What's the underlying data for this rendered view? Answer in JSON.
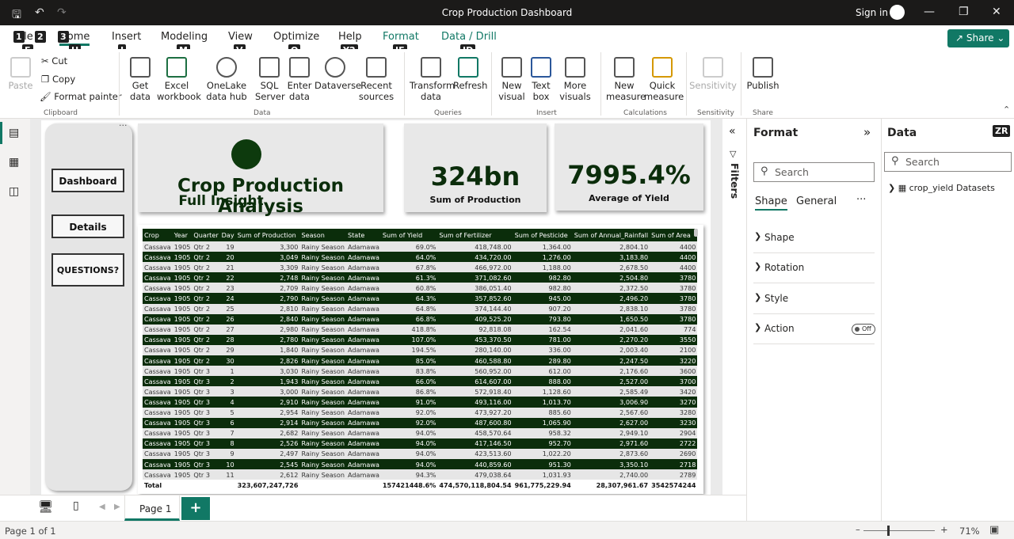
{
  "window": {
    "title": "Crop Production Dashboard",
    "sign_in": "Sign in"
  },
  "tabs": [
    "File",
    "Home",
    "Insert",
    "Modeling",
    "View",
    "Optimize",
    "Help",
    "Format",
    "Data / Drill"
  ],
  "keytips": {
    "file": "1",
    "tb2": "2",
    "tb3": "3",
    "home": "H",
    "insert": "I",
    "modeling": "M",
    "view": "V",
    "optimize": "O",
    "help": "Y2",
    "format": "JF",
    "drill": "JD",
    "paste": "F",
    "share": "S",
    "data": "ZR"
  },
  "share": "Share",
  "clipboard": {
    "paste": "Paste",
    "cut": "Cut",
    "copy": "Copy",
    "format_painter": "Format painter",
    "group": "Clipboard"
  },
  "data_group": {
    "get_data": "Get data",
    "excel": "Excel workbook",
    "onelake": "OneLake data hub",
    "sql": "SQL Server",
    "enter": "Enter data",
    "dataverse": "Dataverse",
    "recent": "Recent sources",
    "group": "Data"
  },
  "queries": {
    "transform": "Transform data",
    "refresh": "Refresh",
    "group": "Queries"
  },
  "insert_group": {
    "new_visual": "New visual",
    "text_box": "Text box",
    "more": "More visuals",
    "group": "Insert"
  },
  "calc": {
    "new_measure": "New measure",
    "quick": "Quick measure",
    "group": "Calculations"
  },
  "sens": {
    "label": "Sensitivity",
    "group": "Sensitivity"
  },
  "share_group": {
    "publish": "Publish",
    "group": "Share"
  },
  "nav": [
    "Dashboard",
    "Details",
    "QUESTIONS?"
  ],
  "header": {
    "title": "Crop Production Analysis",
    "subtitle": "Full Insight"
  },
  "kpi1": {
    "value": "324bn",
    "label": "Sum of Production"
  },
  "kpi2": {
    "value": "7995.4%",
    "label": "Average of Yield"
  },
  "table": {
    "columns": [
      "Crop",
      "Year",
      "Quarter",
      "Day",
      "Sum of Production",
      "Season",
      "State",
      "Sum of Yield",
      "Sum of Fertilizer",
      "Sum of Pesticide",
      "Sum of Annual_Rainfall",
      "Sum of Area"
    ],
    "rows": [
      [
        "Cassava",
        "1905",
        "Qtr 2",
        "19",
        "3,300",
        "Rainy Season",
        "Adamawa",
        "69.0%",
        "418,748.00",
        "1,364.00",
        "2,804.10",
        "4400"
      ],
      [
        "Cassava",
        "1905",
        "Qtr 2",
        "20",
        "3,049",
        "Rainy Season",
        "Adamawa",
        "64.0%",
        "434,720.00",
        "1,276.00",
        "3,183.80",
        "4400"
      ],
      [
        "Cassava",
        "1905",
        "Qtr 2",
        "21",
        "3,309",
        "Rainy Season",
        "Adamawa",
        "67.8%",
        "466,972.00",
        "1,188.00",
        "2,678.50",
        "4400"
      ],
      [
        "Cassava",
        "1905",
        "Qtr 2",
        "22",
        "2,748",
        "Rainy Season",
        "Adamawa",
        "61.3%",
        "371,082.60",
        "982.80",
        "2,504.80",
        "3780"
      ],
      [
        "Cassava",
        "1905",
        "Qtr 2",
        "23",
        "2,709",
        "Rainy Season",
        "Adamawa",
        "60.8%",
        "386,051.40",
        "982.80",
        "2,372.50",
        "3780"
      ],
      [
        "Cassava",
        "1905",
        "Qtr 2",
        "24",
        "2,790",
        "Rainy Season",
        "Adamawa",
        "64.3%",
        "357,852.60",
        "945.00",
        "2,496.20",
        "3780"
      ],
      [
        "Cassava",
        "1905",
        "Qtr 2",
        "25",
        "2,810",
        "Rainy Season",
        "Adamawa",
        "64.8%",
        "374,144.40",
        "907.20",
        "2,838.10",
        "3780"
      ],
      [
        "Cassava",
        "1905",
        "Qtr 2",
        "26",
        "2,840",
        "Rainy Season",
        "Adamawa",
        "66.8%",
        "409,525.20",
        "793.80",
        "1,650.50",
        "3780"
      ],
      [
        "Cassava",
        "1905",
        "Qtr 2",
        "27",
        "2,980",
        "Rainy Season",
        "Adamawa",
        "418.8%",
        "92,818.08",
        "162.54",
        "2,041.60",
        "774"
      ],
      [
        "Cassava",
        "1905",
        "Qtr 2",
        "28",
        "2,780",
        "Rainy Season",
        "Adamawa",
        "107.0%",
        "453,370.50",
        "781.00",
        "2,270.20",
        "3550"
      ],
      [
        "Cassava",
        "1905",
        "Qtr 2",
        "29",
        "1,840",
        "Rainy Season",
        "Adamawa",
        "194.5%",
        "280,140.00",
        "336.00",
        "2,003.40",
        "2100"
      ],
      [
        "Cassava",
        "1905",
        "Qtr 2",
        "30",
        "2,826",
        "Rainy Season",
        "Adamawa",
        "85.0%",
        "460,588.80",
        "289.80",
        "2,247.50",
        "3220"
      ],
      [
        "Cassava",
        "1905",
        "Qtr 3",
        "1",
        "3,030",
        "Rainy Season",
        "Adamawa",
        "83.8%",
        "560,952.00",
        "612.00",
        "2,176.60",
        "3600"
      ],
      [
        "Cassava",
        "1905",
        "Qtr 3",
        "2",
        "1,943",
        "Rainy Season",
        "Adamawa",
        "66.0%",
        "614,607.00",
        "888.00",
        "2,527.00",
        "3700"
      ],
      [
        "Cassava",
        "1905",
        "Qtr 3",
        "3",
        "3,000",
        "Rainy Season",
        "Adamawa",
        "86.8%",
        "572,918.40",
        "1,128.60",
        "2,585.49",
        "3420"
      ],
      [
        "Cassava",
        "1905",
        "Qtr 3",
        "4",
        "2,910",
        "Rainy Season",
        "Adamawa",
        "91.0%",
        "493,116.00",
        "1,013.70",
        "3,006.90",
        "3270"
      ],
      [
        "Cassava",
        "1905",
        "Qtr 3",
        "5",
        "2,954",
        "Rainy Season",
        "Adamawa",
        "92.0%",
        "473,927.20",
        "885.60",
        "2,567.60",
        "3280"
      ],
      [
        "Cassava",
        "1905",
        "Qtr 3",
        "6",
        "2,914",
        "Rainy Season",
        "Adamawa",
        "92.0%",
        "487,600.80",
        "1,065.90",
        "2,627.00",
        "3230"
      ],
      [
        "Cassava",
        "1905",
        "Qtr 3",
        "7",
        "2,682",
        "Rainy Season",
        "Adamawa",
        "94.0%",
        "458,570.64",
        "958.32",
        "2,949.10",
        "2904"
      ],
      [
        "Cassava",
        "1905",
        "Qtr 3",
        "8",
        "2,526",
        "Rainy Season",
        "Adamawa",
        "94.0%",
        "417,146.50",
        "952.70",
        "2,971.60",
        "2722"
      ],
      [
        "Cassava",
        "1905",
        "Qtr 3",
        "9",
        "2,497",
        "Rainy Season",
        "Adamawa",
        "94.0%",
        "423,513.60",
        "1,022.20",
        "2,873.60",
        "2690"
      ],
      [
        "Cassava",
        "1905",
        "Qtr 3",
        "10",
        "2,545",
        "Rainy Season",
        "Adamawa",
        "94.0%",
        "440,859.60",
        "951.30",
        "3,350.10",
        "2718"
      ],
      [
        "Cassava",
        "1905",
        "Qtr 3",
        "11",
        "2,612",
        "Rainy Season",
        "Adamawa",
        "94.3%",
        "479,038.64",
        "1,031.93",
        "2,740.00",
        "2789"
      ]
    ],
    "total": [
      "Total",
      "",
      "",
      "",
      "323,607,247,726",
      "",
      "",
      "157421448.6%",
      "474,570,118,804.54",
      "961,775,229.94",
      "28,307,961.67",
      "3542574244"
    ]
  },
  "filters": "Filters",
  "format_pane": {
    "title": "Format",
    "search": "Search",
    "tabs": [
      "Shape",
      "General"
    ],
    "sections": [
      "Shape",
      "Rotation",
      "Style",
      "Action"
    ],
    "toggle": "Off"
  },
  "data_pane": {
    "title": "Data",
    "search": "Search",
    "dataset": "crop_yield Datasets"
  },
  "pages": {
    "tab": "Page 1",
    "add": "+"
  },
  "status": {
    "page": "Page 1 of 1",
    "zoom": "71%"
  }
}
